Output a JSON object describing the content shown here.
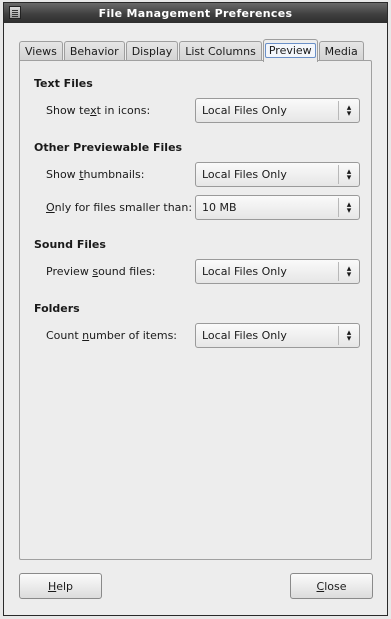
{
  "window": {
    "title": "File Management Preferences"
  },
  "tabs": [
    {
      "label": "Views"
    },
    {
      "label": "Behavior"
    },
    {
      "label": "Display"
    },
    {
      "label": "List Columns"
    },
    {
      "label": "Preview"
    },
    {
      "label": "Media"
    }
  ],
  "active_tab": "Preview",
  "sections": {
    "text_files": {
      "heading": "Text Files",
      "show_text_pre": "Show te",
      "show_text_mn": "x",
      "show_text_post": "t in icons:",
      "show_text_value": "Local Files Only"
    },
    "other_previewable": {
      "heading": "Other Previewable Files",
      "thumb_pre": "Show ",
      "thumb_mn": "t",
      "thumb_post": "humbnails:",
      "thumb_value": "Local Files Only",
      "size_mn": "O",
      "size_post": "nly for files smaller than:",
      "size_value": "10 MB"
    },
    "sound_files": {
      "heading": "Sound Files",
      "sound_pre": "Preview ",
      "sound_mn": "s",
      "sound_post": "ound files:",
      "sound_value": "Local Files Only"
    },
    "folders": {
      "heading": "Folders",
      "count_pre": "Count ",
      "count_mn": "n",
      "count_post": "umber of items:",
      "count_value": "Local Files Only"
    }
  },
  "buttons": {
    "help_mn": "H",
    "help_post": "elp",
    "close_mn": "C",
    "close_post": "lose"
  },
  "icons": {
    "window_icon": "window-menu-icon",
    "combo_arrows": "up-down-arrows-icon"
  }
}
